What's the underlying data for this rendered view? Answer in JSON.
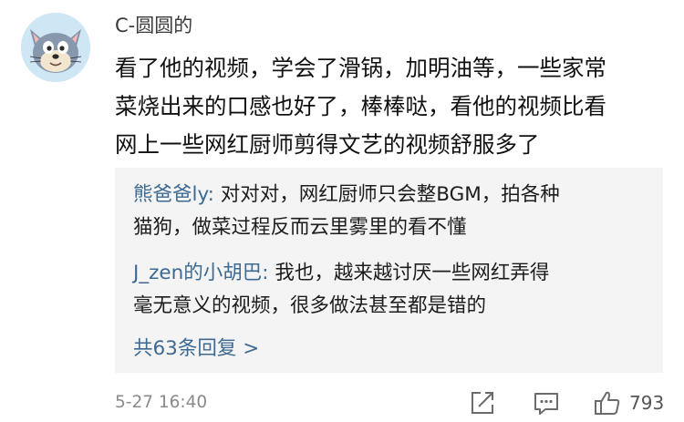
{
  "comment": {
    "username": "C-圆圆的",
    "body_lines": [
      "看了他的视频，学会了滑锅，加明油等，一些家常",
      "菜烧出来的口感也好了，棒棒哒，看他的视频比看",
      "网上一些网红厨师剪得文艺的视频舒服多了"
    ],
    "timestamp": "5-27 16:40",
    "likes": "793"
  },
  "replies": [
    {
      "author": "熊爸爸ly:",
      "line1": " 对对对，网红厨师只会整BGM，拍各种",
      "line2": "猫狗，做菜过程反而云里雾里的看不懂"
    },
    {
      "author": "J_zen的小胡巴:",
      "line1": " 我也，越来越讨厌一些网红弄得",
      "line2": "毫无意义的视频，很多做法甚至都是错的"
    }
  ],
  "more_replies": "共63条回复 >",
  "icons": {
    "share": "share-icon",
    "comment": "comment-icon",
    "like": "thumbs-up-icon"
  },
  "colors": {
    "link": "#3d6a93",
    "reply_bg": "#f4f4f4",
    "meta": "#8a8a8a"
  }
}
